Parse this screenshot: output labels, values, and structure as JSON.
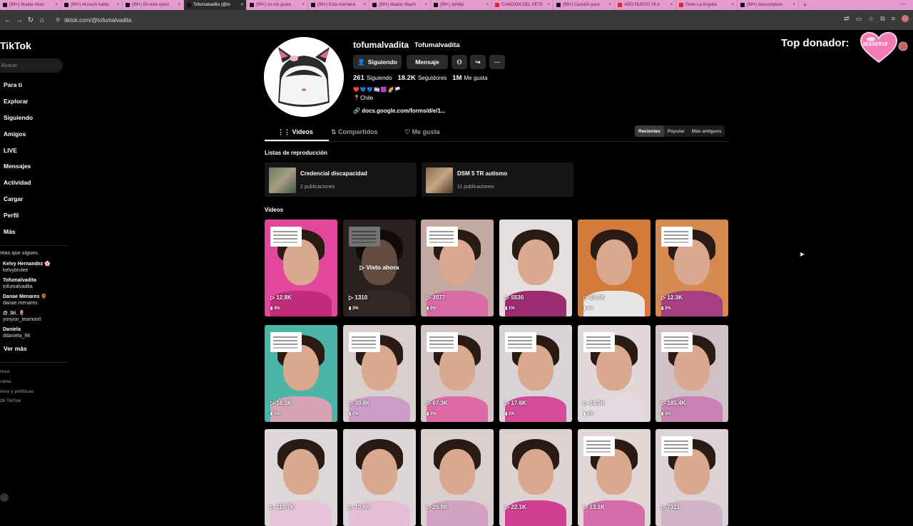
{
  "browser": {
    "tabs": [
      {
        "title": "(99+) #bailar #barr",
        "yt": false
      },
      {
        "title": "(99+) #ersech habla",
        "yt": false
      },
      {
        "title": "(99+) En este episo",
        "yt": false
      },
      {
        "title": "Tofumalvadita (@to",
        "yt": false,
        "active": true
      },
      {
        "title": "(99+) no me gusta",
        "yt": false
      },
      {
        "title": "(99+) Esta mamarra",
        "yt": false
      },
      {
        "title": "(99+) #bailar #bach",
        "yt": false
      },
      {
        "title": "(99+) #philip",
        "yt": false
      },
      {
        "title": "CANCION DEL VETE",
        "yt": true
      },
      {
        "title": "(99+) Canción para",
        "yt": false
      },
      {
        "title": "AÑO NUEVO YA A",
        "yt": true
      },
      {
        "title": "Peter La Anguila",
        "yt": true
      },
      {
        "title": "(99+) #assumption",
        "yt": false
      }
    ],
    "url": "tiktok.com/@tofumalvadita"
  },
  "sidebar": {
    "brand": "TikTok",
    "search_placeholder": "Buscar",
    "nav": [
      "Para ti",
      "Explorar",
      "Siguiendo",
      "Amigos",
      "LIVE",
      "Mensajes",
      "Actividad",
      "Cargar",
      "Perfil",
      "Más"
    ],
    "following_title": "ntas que sigues",
    "following": [
      {
        "name": "Kelvy Hernandez 🌸",
        "user": "kelvybrulee"
      },
      {
        "name": "Tofumalvadita",
        "user": "tofumalvadita"
      },
      {
        "name": "Danae Menares 🌻",
        "user": "danae.menares"
      },
      {
        "name": "@_lzi_🌷",
        "user": "yonyon_teamoo0"
      },
      {
        "name": "Daniela",
        "user": "ddaniela_96"
      }
    ],
    "see_more": "Ver más",
    "footer": [
      "resa",
      "rama",
      "inos y políticas",
      "26 TikTok"
    ]
  },
  "profile": {
    "username": "tofumalvadita",
    "nickname": "Tofumalvadita",
    "buttons": {
      "following": "Siguiendo",
      "message": "Mensaje"
    },
    "stats": [
      {
        "value": "261",
        "label": "Siguiendo"
      },
      {
        "value": "18.2K",
        "label": "Seguidores"
      },
      {
        "value": "1M",
        "label": "Me gusta"
      }
    ],
    "bio_emojis": "❤️💙💙🏳️‍⚧️🟪🌈🏳️",
    "country": "📍Chile",
    "link": "docs.google.com/forms/d/e/1..."
  },
  "tabs": {
    "items": [
      "Videos",
      "Compartidos",
      "Me gusta"
    ],
    "sort": [
      "Recientes",
      "Popular",
      "Más antiguos"
    ]
  },
  "playlists": {
    "title": "Listas de reproducción",
    "items": [
      {
        "title": "Credencial discapacidad",
        "count": "2 publicaciones"
      },
      {
        "title": "DSM 5 TR autismo",
        "count": "11 publicaciones"
      }
    ]
  },
  "videos": {
    "title": "Videos",
    "watched_label": "Visto ahora",
    "items": [
      {
        "views": "12.8K",
        "pct": "4%",
        "bg": "#e0479d",
        "shirt": "#c22b7c",
        "note": true
      },
      {
        "views": "1310",
        "pct": "3%",
        "bg": "#5b4a48",
        "shirt": "#6d5a58",
        "note": true,
        "watched": true
      },
      {
        "views": "3977",
        "pct": "2%",
        "bg": "#c4a9a2",
        "shirt": "#d86aa6",
        "note": true
      },
      {
        "views": "5530",
        "pct": "1%",
        "bg": "#e4dedf",
        "shirt": "#9c2b72",
        "note": false
      },
      {
        "views": "35.3K",
        "pct": "4%",
        "bg": "#d37b3c",
        "shirt": "#e8e5e5",
        "note": false
      },
      {
        "views": "12.3K",
        "pct": "2%",
        "bg": "#d78a4f",
        "shirt": "#a83d82",
        "note": true
      },
      {
        "views": "16.3K",
        "pct": "1%",
        "bg": "#4bb5a7",
        "shirt": "#d6a3b7",
        "note": true
      },
      {
        "views": "39.8K",
        "pct": "2%",
        "bg": "#d9cfcf",
        "shirt": "#cc9bc8",
        "note": true
      },
      {
        "views": "67.3K",
        "pct": "2%",
        "bg": "#d3c6c4",
        "shirt": "#e06aa6",
        "note": true
      },
      {
        "views": "17.6K",
        "pct": "1%",
        "bg": "#d7d3d7",
        "shirt": "#d44b98",
        "note": true
      },
      {
        "views": "14.9K",
        "pct": "1%",
        "bg": "#e1d9d9",
        "shirt": "#e4d7df",
        "note": true
      },
      {
        "views": "185.4K",
        "pct": "3%",
        "bg": "#cfc1c6",
        "shirt": "#c980b4",
        "note": true
      },
      {
        "views": "118.7K",
        "pct": "",
        "bg": "#ded7d7",
        "shirt": "#e6c4d8",
        "note": false
      },
      {
        "views": "10.8K",
        "pct": "",
        "bg": "#ddd6d8",
        "shirt": "#e6bfd6",
        "note": false
      },
      {
        "views": "26.8K",
        "pct": "",
        "bg": "#d7d0cf",
        "shirt": "#d4a3c4",
        "note": false
      },
      {
        "views": "22.1K",
        "pct": "",
        "bg": "#ddd2d2",
        "shirt": "#cf3f92",
        "note": false
      },
      {
        "views": "13.1K",
        "pct": "",
        "bg": "#e0d6d5",
        "shirt": "#d76ea9",
        "note": true
      },
      {
        "views": "7321",
        "pct": "",
        "bg": "#dcd3d6",
        "shirt": "#cfb3c8",
        "note": true
      }
    ]
  },
  "overlay": {
    "top_donor_label": "Top donador:",
    "donor_name": "JESSER18"
  }
}
